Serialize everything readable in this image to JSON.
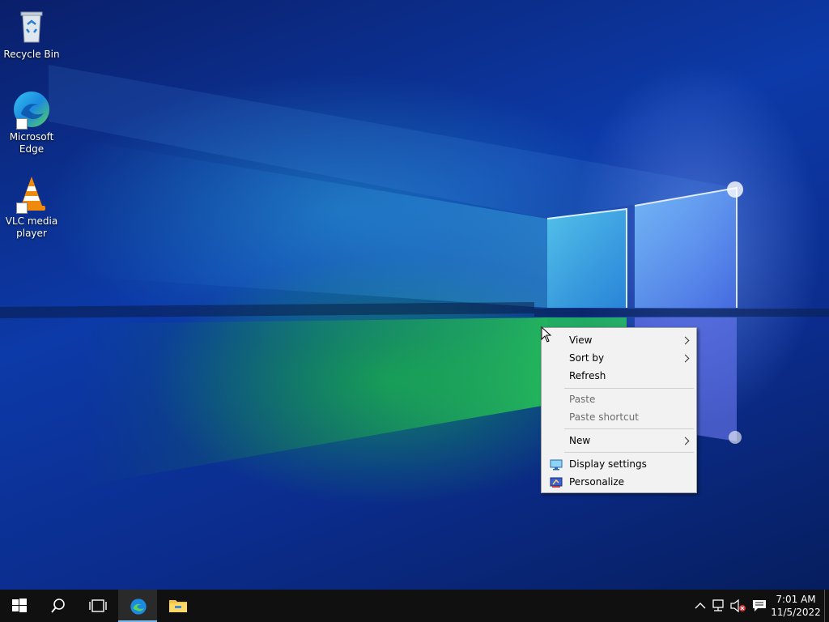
{
  "desktop": {
    "icons": [
      {
        "label": "Recycle Bin",
        "icon": "recycle-bin-icon"
      },
      {
        "label": "Microsoft Edge",
        "icon": "edge-icon"
      },
      {
        "label": "VLC media player",
        "icon": "vlc-icon"
      }
    ]
  },
  "context_menu": {
    "items": [
      {
        "label": "View",
        "submenu": true,
        "enabled": true
      },
      {
        "label": "Sort by",
        "submenu": true,
        "enabled": true
      },
      {
        "label": "Refresh",
        "submenu": false,
        "enabled": true
      },
      {
        "label": "Paste",
        "submenu": false,
        "enabled": false
      },
      {
        "label": "Paste shortcut",
        "submenu": false,
        "enabled": false
      },
      {
        "label": "New",
        "submenu": true,
        "enabled": true
      },
      {
        "label": "Display settings",
        "submenu": false,
        "enabled": true,
        "icon": "display-icon"
      },
      {
        "label": "Personalize",
        "submenu": false,
        "enabled": true,
        "icon": "personalize-icon"
      }
    ]
  },
  "taskbar": {
    "buttons": [
      "start-icon",
      "search-icon",
      "task-view-icon",
      "edge-icon",
      "file-explorer-icon"
    ],
    "tray_icons": [
      "chevron-up-icon",
      "network-icon",
      "volume-muted-icon",
      "notification-icon"
    ],
    "clock": {
      "time": "7:01 AM",
      "date": "11/5/2022"
    }
  },
  "colors": {
    "taskbar": "#101010",
    "menu_bg": "#f2f2f2",
    "active_indicator": "#76b9ed"
  }
}
